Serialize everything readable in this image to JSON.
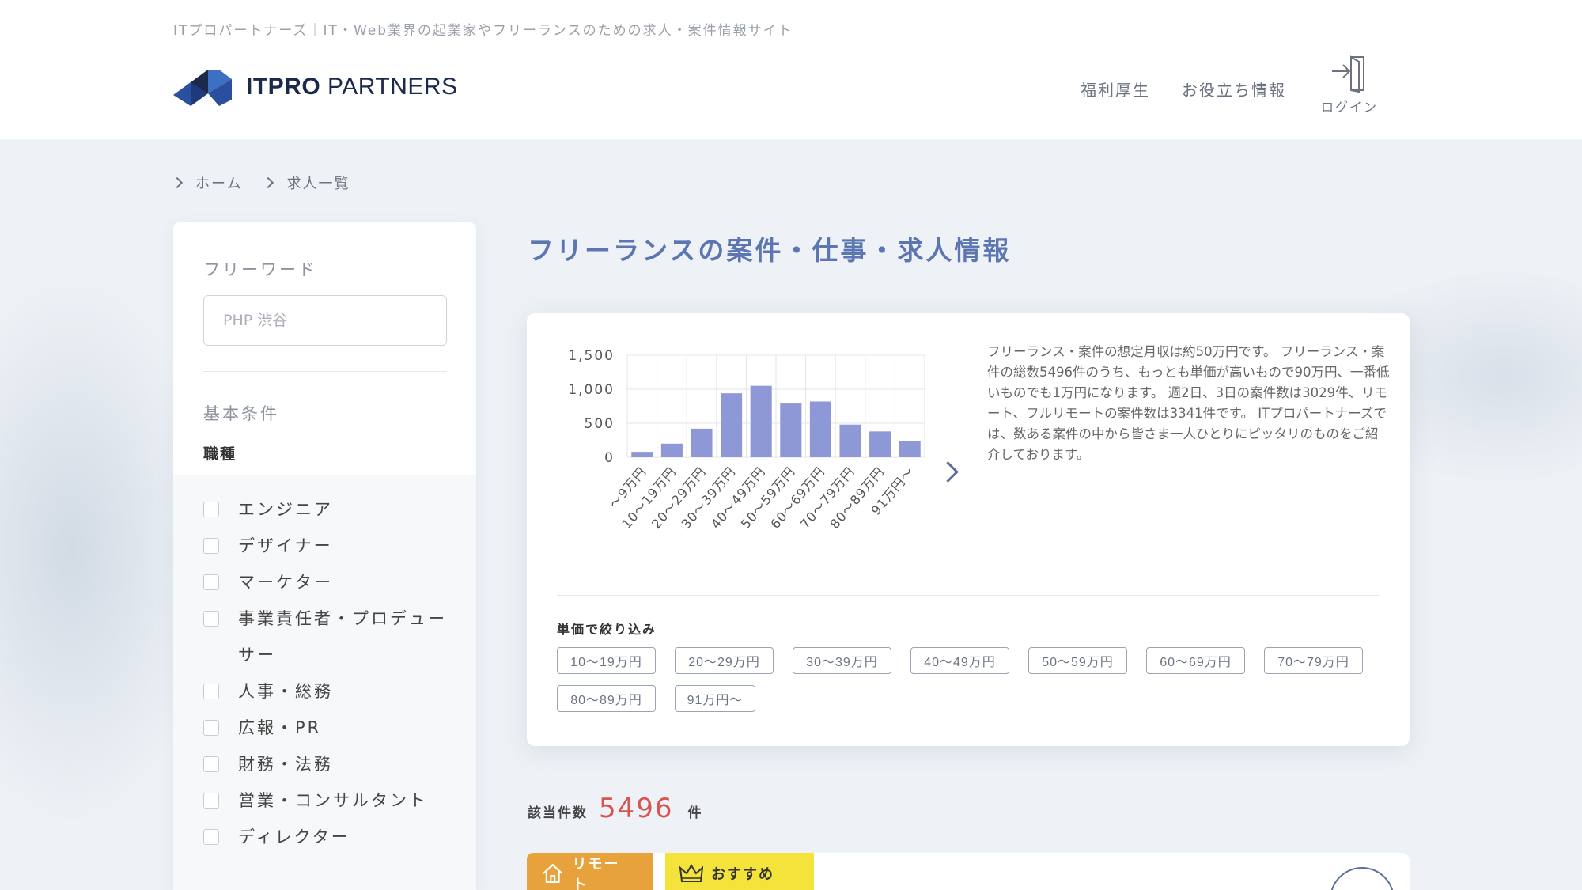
{
  "header": {
    "tagline": "ITプロパートナーズ｜IT・Web業界の起業家やフリーランスのための求人・案件情報サイト",
    "logo_bold": "ITPRO",
    "logo_rest": " PARTNERS",
    "nav": {
      "welfare": "福利厚生",
      "info": "お役立ち情報"
    },
    "login_label": "ログイン"
  },
  "breadcrumb": {
    "home": "ホーム",
    "current": "求人一覧"
  },
  "sidebar": {
    "freeword_label": "フリーワード",
    "search_placeholder": "PHP 渋谷",
    "basic_label": "基本条件",
    "job_label": "職種",
    "jobs": [
      "エンジニア",
      "デザイナー",
      "マーケター",
      "事業責任者・プロデューサー",
      "人事・総務",
      "広報・PR",
      "財務・法務",
      "営業・コンサルタント",
      "ディレクター"
    ]
  },
  "main": {
    "title": "フリーランスの案件・仕事・求人情報",
    "description": "フリーランス・案件の想定月収は約50万円です。 フリーランス・案件の総数5496件のうち、もっとも単価が高いもので90万円、一番低いものでも1万円になります。 週2日、3日の案件数は3029件、リモート、フルリモートの案件数は3341件です。 ITプロパートナーズでは、数ある案件の中から皆さま一人ひとりにピッタリのものをご紹介しております。",
    "filter_label": "単価で絞り込み",
    "filters": [
      "10〜19万円",
      "20〜29万円",
      "30〜39万円",
      "40〜49万円",
      "50〜59万円",
      "60〜69万円",
      "70〜79万円",
      "80〜89万円",
      "91万円〜"
    ],
    "count_label": "該当件数",
    "count_value": "5496",
    "count_unit": "件",
    "tags": {
      "remote": "リモート",
      "recommend": "おすすめ"
    }
  },
  "colors": {
    "accent": "#5b76b0",
    "bar": "#8f98d6",
    "count": "#d9534f",
    "remote_tag": "#e8a23c",
    "recommend_tag": "#f3e33b"
  },
  "chart_data": {
    "type": "bar",
    "categories": [
      "〜9万円",
      "10〜19万円",
      "20〜29万円",
      "30〜39万円",
      "40〜49万円",
      "50〜59万円",
      "60〜69万円",
      "70〜79万円",
      "80〜89万円",
      "91万円〜"
    ],
    "values": [
      80,
      200,
      420,
      940,
      1050,
      790,
      820,
      480,
      380,
      240
    ],
    "yticks": [
      "0",
      "500",
      "1,000",
      "1,500"
    ],
    "ylim": [
      0,
      1500
    ],
    "grid": true
  }
}
